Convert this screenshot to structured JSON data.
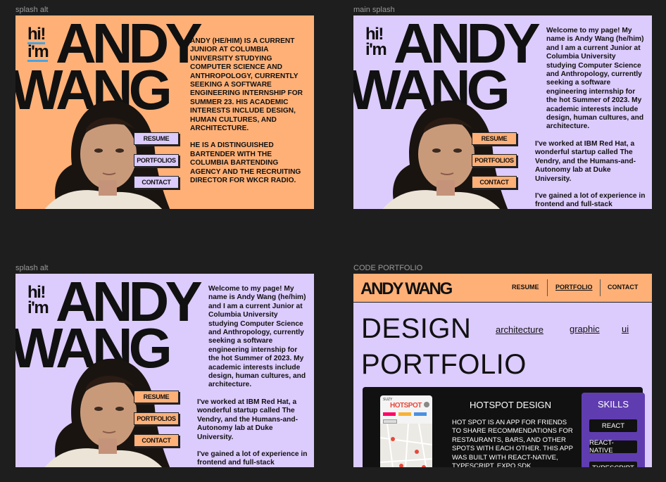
{
  "frames": [
    {
      "label": "splash alt",
      "hi_line1": "hi!",
      "hi_line2": "i'm",
      "name_line1": "ANDY",
      "name_line2": "WANG"
    },
    {
      "label": "main splash",
      "hi_line1": "hi!",
      "hi_line2": "i'm",
      "name_line1": "ANDY",
      "name_line2": "WANG"
    },
    {
      "label": "splash alt",
      "hi_line1": "hi!",
      "hi_line2": "i'm",
      "name_line1": "ANDY",
      "name_line2": "WANG"
    },
    {
      "label": "CODE PORTFOLIO"
    }
  ],
  "nav": {
    "resume": "RESUME",
    "portfolios": "PORTFOLIOS",
    "contact": "CONTACT"
  },
  "bio_upper": {
    "p1": "ANDY (HE/HIM) IS A CURRENT JUNIOR AT COLUMBIA UNIVERSITY STUDYING COMPUTER SCIENCE AND ANTHROPOLOGY, CURRENTLY SEEKING A SOFTWARE ENGINEERING INTERNSHIP FOR SUMMER 23. HIS ACADEMIC INTERESTS INCLUDE DESIGN, HUMAN CULTURES, AND ARCHITECTURE.",
    "p2": "HE IS A DISTINGUISHED BARTENDER WITH THE COLUMBIA BARTENDING AGENCY AND THE RECRUITING DIRECTOR FOR WKCR RADIO."
  },
  "bio_main": {
    "p1": "Welcome to my page! My name is Andy Wang (he/him) and I am a current Junior at Columbia University studying Computer Science and Anthropology, currently seeking a software engineering internship for the hot Summer of 2023. My academic interests include design, human cultures, and architecture.",
    "p2": "I've worked at IBM Red Hat, a wonderful startup called The Vendry, and the Humans-and-Autonomy lab at Duke University.",
    "p3": "I've gained a lot of experience in frontend and full-stack programming, including React,"
  },
  "portfolio": {
    "logo": "ANDY WANG",
    "nav": {
      "resume": "RESUME",
      "portfolio": "PORTFOLIO",
      "contact": "CONTACT"
    },
    "title_line1": "DESIGN",
    "title_line2": "PORTFOLIO",
    "links": {
      "architecture": "architecture",
      "graphic": "graphic",
      "ui": "ui"
    },
    "card": {
      "title": "HOTSPOT DESIGN",
      "desc": "HOT SPOT IS AN APP FOR FRIENDS TO SHARE RECOMMENDATIONS FOR RESTAURANTS, BARS, AND OTHER SPOTS WITH EACH OTHER. THIS APP WAS BUILT WITH REACT-NATIVE, TYPESCRIPT, EXPO SDK,",
      "phone_logo": "HOTSPOT",
      "phone_header": "SUZY",
      "skills_title": "SKILLS",
      "skills": [
        "REACT",
        "REACT-NATIVE",
        "TYPESCRIPT"
      ]
    }
  },
  "colors": {
    "canvas": "#1e1e1e",
    "orange": "#ffb077",
    "lavender": "#dccbfd",
    "accent_blue": "#4aa3df",
    "skills_purple": "#5f3db0"
  }
}
